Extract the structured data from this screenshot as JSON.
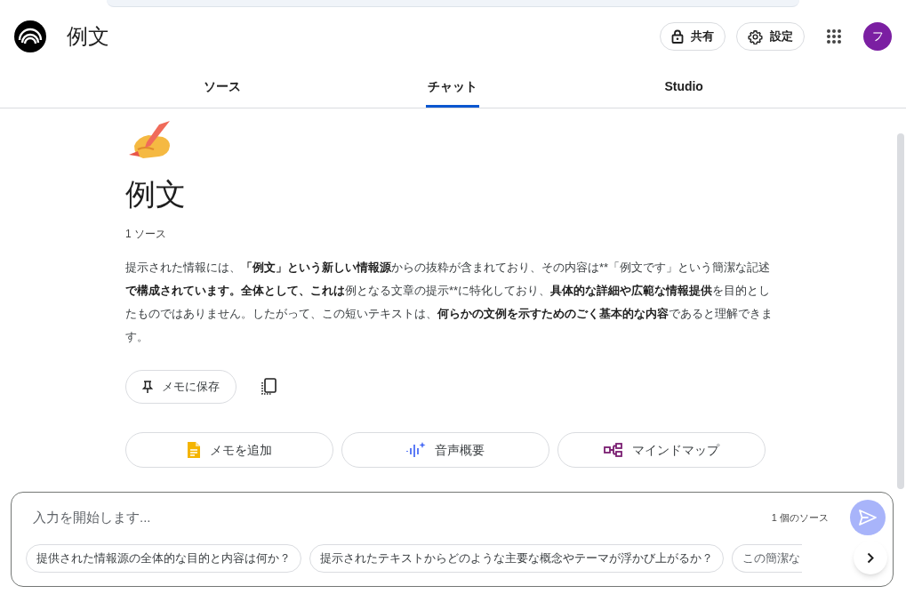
{
  "header": {
    "title": "例文",
    "share_button": "共有",
    "settings_button": "設定",
    "avatar": "フ"
  },
  "tabs": [
    {
      "label": "ソース",
      "selected": false
    },
    {
      "label": "チャット",
      "selected": true
    },
    {
      "label": "Studio",
      "selected": false
    }
  ],
  "notebook": {
    "title": "例文",
    "source_count": "1 ソース",
    "summary": [
      {
        "text": "提示された情報には、",
        "bold": false
      },
      {
        "text": "「例文」という新しい情報源",
        "bold": true
      },
      {
        "text": "からの抜粋が含まれており、その内容は**「例文です」という簡潔な記述",
        "bold": false
      },
      {
        "text": "で構成されています。全体として、これは",
        "bold": true
      },
      {
        "text": "例となる文章の提示**に特化しており、",
        "bold": false
      },
      {
        "text": "具体的な詳細や広範な情報提供",
        "bold": true
      },
      {
        "text": "を目的としたものではありません。したがって、この短いテキストは、",
        "bold": false
      },
      {
        "text": "何らかの文例を示すためのごく基本的な内容",
        "bold": true
      },
      {
        "text": "であると理解できます。",
        "bold": false
      }
    ],
    "save_button": "メモに保存",
    "actions": [
      {
        "kind": "note",
        "label": "メモを追加"
      },
      {
        "kind": "audio",
        "label": "音声概要"
      },
      {
        "kind": "mindmap",
        "label": "マインドマップ"
      }
    ]
  },
  "chat_input": {
    "placeholder": "入力を開始します...",
    "source_count": "1 個のソース",
    "suggestions": [
      "提供された情報源の全体的な目的と内容は何か？",
      "提示されたテキストからどのような主要な概念やテーマが浮かび上がるか？",
      "この簡潔な"
    ]
  }
}
